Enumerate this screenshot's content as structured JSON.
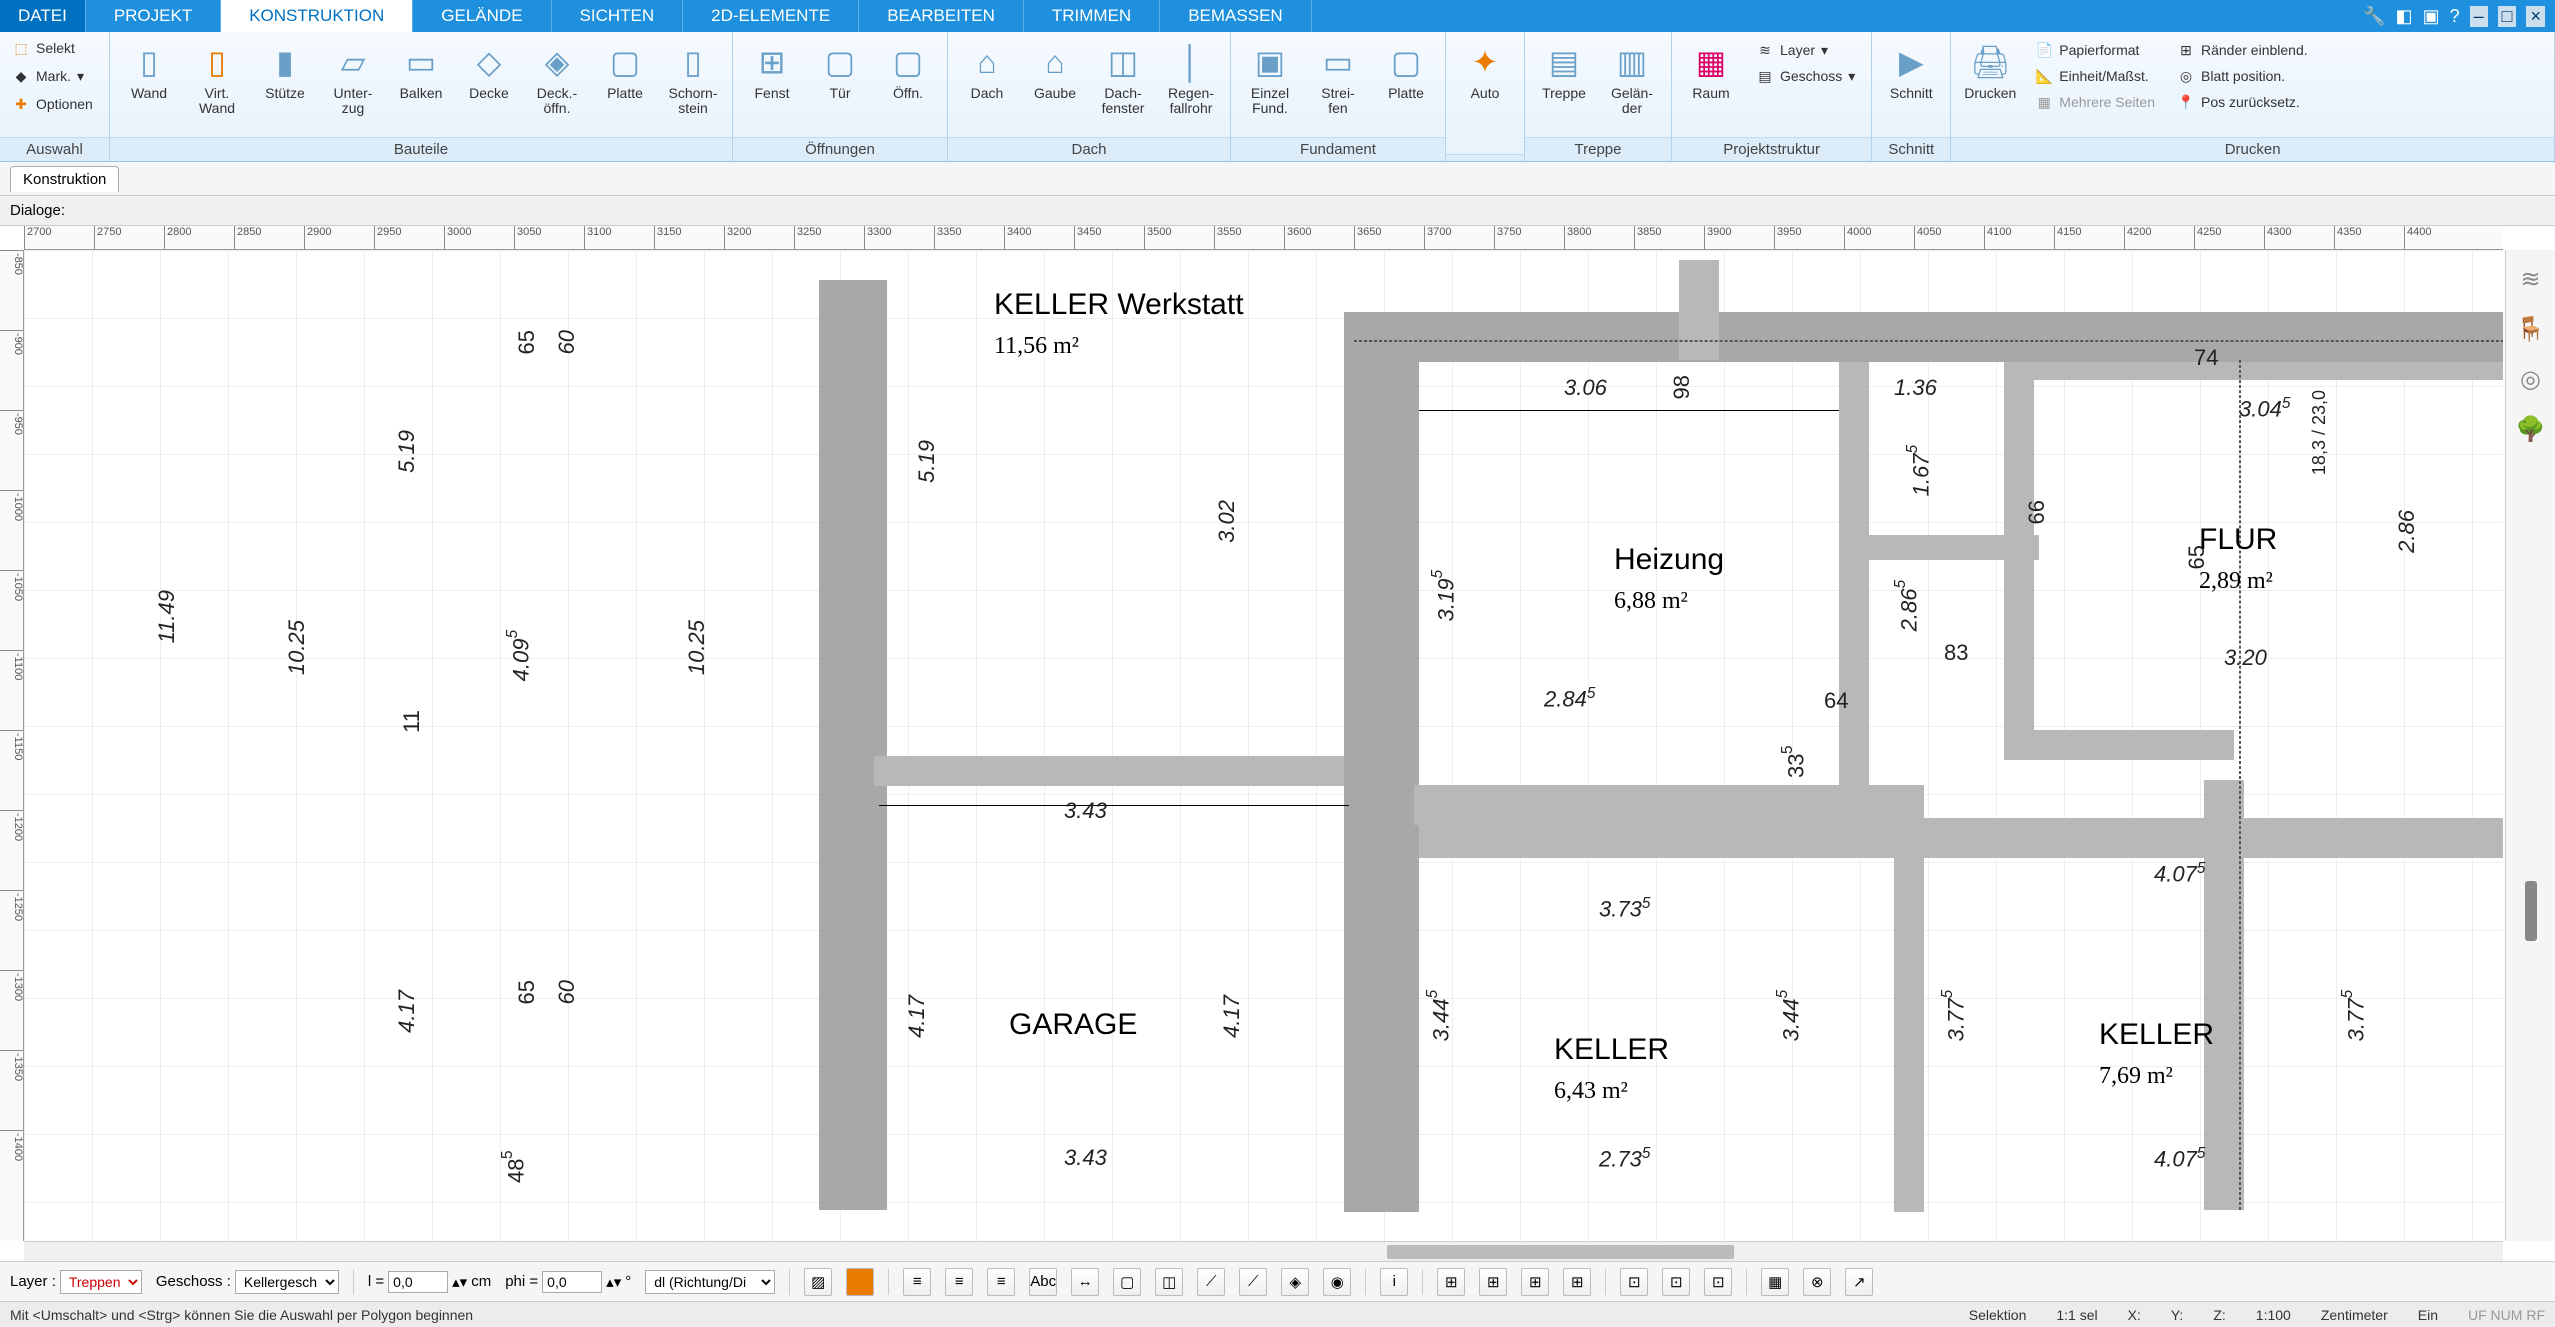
{
  "menu": {
    "file": "DATEI",
    "tabs": [
      "PROJEKT",
      "KONSTRUKTION",
      "GELÄNDE",
      "SICHTEN",
      "2D-ELEMENTE",
      "BEARBEITEN",
      "TRIMMEN",
      "BEMASSEN"
    ],
    "active": "KONSTRUKTION"
  },
  "ribbon": {
    "auswahl": {
      "label": "Auswahl",
      "selekt": "Selekt",
      "mark": "Mark.",
      "optionen": "Optionen"
    },
    "bauteile": {
      "label": "Bauteile",
      "items": [
        "Wand",
        "Virt.\nWand",
        "Stütze",
        "Unter-\nzug",
        "Balken",
        "Decke",
        "Deck.-\nöffn.",
        "Platte",
        "Schorn-\nstein"
      ]
    },
    "oeffnungen": {
      "label": "Öffnungen",
      "items": [
        "Fenst",
        "Tür",
        "Öffn."
      ]
    },
    "dach": {
      "label": "Dach",
      "items": [
        "Dach",
        "Gaube",
        "Dach-\nfenster",
        "Regen-\nfallrohr"
      ]
    },
    "fundament": {
      "label": "Fundament",
      "items": [
        "Einzel\nFund.",
        "Strei-\nfen",
        "Platte"
      ]
    },
    "auto": {
      "label": "",
      "items": [
        "Auto"
      ]
    },
    "treppe": {
      "label": "Treppe",
      "items": [
        "Treppe",
        "Gelän-\nder"
      ]
    },
    "projekt": {
      "label": "Projektstruktur",
      "raum": "Raum",
      "layer": "Layer",
      "geschoss": "Geschoss"
    },
    "schnitt": {
      "label": "Schnitt",
      "items": [
        "Schnitt"
      ]
    },
    "drucken": {
      "label": "Drucken",
      "drucken": "Drucken",
      "papier": "Papierformat",
      "einheit": "Einheit/Maßst.",
      "mehrere": "Mehrere Seiten",
      "raender": "Ränder einblend.",
      "blatt": "Blatt position.",
      "pos": "Pos zurücksetz."
    }
  },
  "subbar": {
    "tab": "Konstruktion"
  },
  "dialog": {
    "label": "Dialoge:"
  },
  "rulerH": [
    "2700",
    "2750",
    "2800",
    "2850",
    "2900",
    "2950",
    "3000",
    "3050",
    "3100",
    "3150",
    "3200",
    "3250",
    "3300",
    "3350",
    "3400",
    "3450",
    "3500",
    "3550",
    "3600",
    "3650",
    "3700",
    "3750",
    "3800",
    "3850",
    "3900",
    "3950",
    "4000",
    "4050",
    "4100",
    "4150",
    "4200",
    "4250",
    "4300",
    "4350",
    "4400"
  ],
  "rulerV": [
    "-850",
    "-900",
    "-950",
    "-1000",
    "-1050",
    "-1100",
    "-1150",
    "-1200",
    "-1250",
    "-1300",
    "-1350",
    "-1400"
  ],
  "rooms": {
    "werkstatt": {
      "name": "KELLER Werkstatt",
      "area": "11,56 m²"
    },
    "heizung": {
      "name": "Heizung",
      "area": "6,88 m²"
    },
    "flur": {
      "name": "FLUR",
      "area": "2,89 m²"
    },
    "garage": {
      "name": "GARAGE"
    },
    "keller1": {
      "name": "KELLER",
      "area": "6,43 m²"
    },
    "keller2": {
      "name": "KELLER",
      "area": "7,69 m²"
    }
  },
  "dims": {
    "d519a": "5.19",
    "d65a": "65",
    "d60a": "60",
    "d1149": "11.49",
    "d1025a": "10.25",
    "d409": "4.09",
    "d1025b": "10.25",
    "d11": "11",
    "d417a": "4.17",
    "d65b": "65",
    "d60b": "60",
    "d48": "48",
    "d519b": "5.19",
    "d302": "3.02",
    "d417b": "4.17",
    "d343a": "3.43",
    "d343b": "3.43",
    "d306": "3.06",
    "d98": "98",
    "d319": "3.19",
    "d284": "2.84",
    "d373": "3.73",
    "d273": "2.73",
    "d344a": "3.44",
    "d344b": "3.44",
    "d33": "33",
    "d136": "1.36",
    "d167": "1.67",
    "d286a": "2.86",
    "d83": "83",
    "d64": "64",
    "d66": "66",
    "d74": "74",
    "d304": "3.04",
    "d183": "18,3 / 23,0",
    "d286b": "2.86",
    "d320": "3.20",
    "d407a": "4.07",
    "d377a": "3.77",
    "d377b": "3.77",
    "d407b": "4.07",
    "d65c": "65"
  },
  "optbar": {
    "layer": "Layer :",
    "layerVal": "Treppen",
    "geschoss": "Geschoss :",
    "geschossVal": "Kellergesch",
    "l": "l =",
    "lVal": "0,0",
    "cm": "cm",
    "phi": "phi =",
    "phiVal": "0,0",
    "deg": "°",
    "mode": "dl (Richtung/Di"
  },
  "status": {
    "hint": "Mit <Umschalt> und <Strg> können Sie die Auswahl per Polygon beginnen",
    "sel": "Selektion",
    "selratio": "1:1 sel",
    "x": "X:",
    "y": "Y:",
    "z": "Z:",
    "scale": "1:100",
    "unit": "Zentimeter",
    "ein": "Ein",
    "uf": "UF",
    "num": "NUM",
    "rf": "RF"
  }
}
